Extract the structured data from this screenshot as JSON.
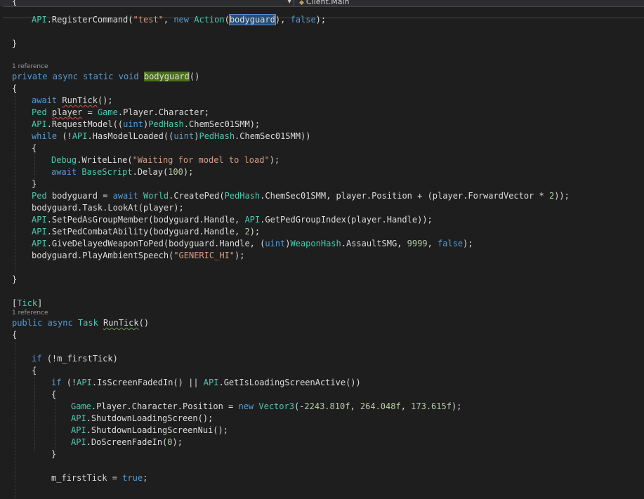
{
  "header": {
    "nav_label": "Client.Main"
  },
  "lines": {
    "l00": "{",
    "l01": [
      "API",
      ".RegisterCommand(",
      "\"test\"",
      ", ",
      "new ",
      "Action",
      "(",
      "bodyguard",
      "), ",
      "false",
      ");"
    ],
    "l03": "}",
    "ref1": "1 reference",
    "l05": [
      "private async static void ",
      "bodyguard",
      "()"
    ],
    "l06": "{",
    "l07": [
      "await ",
      "RunTick",
      "();"
    ],
    "l08": [
      "Ped ",
      "player",
      " = ",
      "Game",
      ".",
      "Player",
      ".",
      "Character",
      ";"
    ],
    "l09": [
      "API",
      ".RequestModel((",
      "uint",
      ")",
      "PedHash",
      ".ChemSec01SMM);"
    ],
    "l10": [
      "while ",
      "(!",
      "API",
      ".HasModelLoaded((",
      "uint",
      ")",
      "PedHash",
      ".ChemSec01SMM))"
    ],
    "l11": "{",
    "l12": [
      "Debug",
      ".WriteLine(",
      "\"Waiting for model to load\"",
      ");"
    ],
    "l13": [
      "await ",
      "BaseScript",
      ".Delay(",
      "100",
      ");"
    ],
    "l14": "}",
    "l15": [
      "Ped ",
      "bodyguard = ",
      "await ",
      "World",
      ".CreatePed(",
      "PedHash",
      ".ChemSec01SMM, player.Position + (player.ForwardVector * ",
      "2",
      "));"
    ],
    "l16": [
      "bodyguard.Task.LookAt(player);"
    ],
    "l17": [
      "API",
      ".SetPedAsGroupMember(bodyguard.Handle, ",
      "API",
      ".GetPedGroupIndex(player.Handle));"
    ],
    "l18": [
      "API",
      ".SetPedCombatAbility(bodyguard.Handle, ",
      "2",
      ");"
    ],
    "l19": [
      "API",
      ".GiveDelayedWeaponToPed(bodyguard.Handle, (",
      "uint",
      ")",
      "WeaponHash",
      ".AssaultSMG, ",
      "9999",
      ", ",
      "false",
      ");"
    ],
    "l20": [
      "bodyguard.PlayAmbientSpeech(",
      "\"GENERIC_HI\"",
      ");"
    ],
    "l22": "}",
    "l24": [
      "[",
      "Tick",
      "]"
    ],
    "ref2": "1 reference",
    "l25": [
      "public async ",
      "Task ",
      "RunTick",
      "()"
    ],
    "l26": "{",
    "l28": [
      "if ",
      "(!m_firstTick)"
    ],
    "l29": "{",
    "l30": [
      "if ",
      "(!",
      "API",
      ".IsScreenFadedIn() || ",
      "API",
      ".GetIsLoadingScreenActive())"
    ],
    "l31": "{",
    "l32": [
      "Game",
      ".",
      "Player",
      ".",
      "Character",
      ".Position = ",
      "new ",
      "Vector3",
      "(-",
      "2243.810f",
      ", ",
      "264.048f",
      ", ",
      "173.615f",
      ");"
    ],
    "l33": [
      "API",
      ".ShutdownLoadingScreen();"
    ],
    "l34": [
      "API",
      ".ShutdownLoadingScreenNui();"
    ],
    "l35": [
      "API",
      ".DoScreenFadeIn(",
      "0",
      ");"
    ],
    "l36": "}",
    "l38": [
      "m_firstTick = ",
      "true",
      ";"
    ]
  }
}
